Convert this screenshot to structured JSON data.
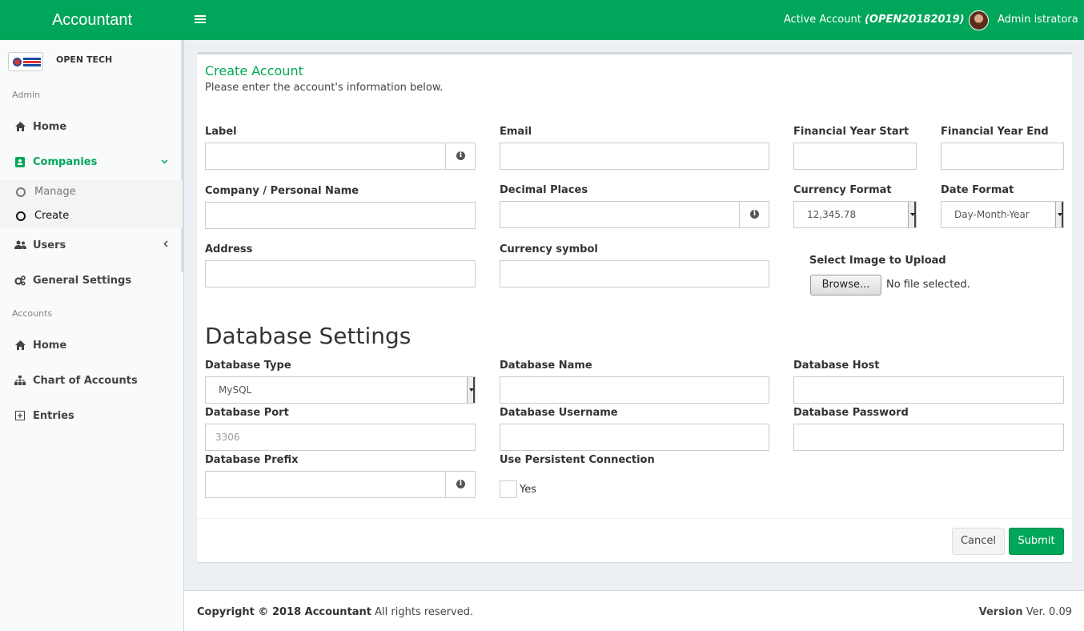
{
  "header": {
    "brand": "Accountant",
    "active_account_label": "Active Account",
    "active_account_code": "(OPEN20182019)",
    "user_name": "Admin istratora"
  },
  "sidebar": {
    "org_name": "OPEN TECH",
    "section_admin": "Admin",
    "section_accounts": "Accounts",
    "admin_items": [
      {
        "label": "Home",
        "icon": "home-icon"
      },
      {
        "label": "Companies",
        "icon": "address-card-icon"
      },
      {
        "label": "Users",
        "icon": "users-icon"
      },
      {
        "label": "General Settings",
        "icon": "gears-icon"
      }
    ],
    "companies_sub": [
      {
        "label": "Manage"
      },
      {
        "label": "Create"
      }
    ],
    "accounts_items": [
      {
        "label": "Home",
        "icon": "home-icon"
      },
      {
        "label": "Chart of Accounts",
        "icon": "sitemap-icon"
      },
      {
        "label": "Entries",
        "icon": "plus-square-icon"
      }
    ]
  },
  "form": {
    "title": "Create Account",
    "subtitle": "Please enter the account's information below.",
    "label_label": "Label",
    "email_label": "Email",
    "fy_start_label": "Financial Year Start",
    "fy_end_label": "Financial Year End",
    "company_label": "Company / Personal Name",
    "decimal_label": "Decimal Places",
    "currency_format_label": "Currency Format",
    "currency_format_value": "12,345.78",
    "date_format_label": "Date Format",
    "date_format_value": "Day-Month-Year",
    "address_label": "Address",
    "currency_symbol_label": "Currency symbol",
    "image_label": "Select Image to Upload",
    "browse_button": "Browse...",
    "file_status": "No file selected."
  },
  "database": {
    "title": "Database Settings",
    "type_label": "Database Type",
    "type_value": "MySQL",
    "name_label": "Database Name",
    "host_label": "Database Host",
    "port_label": "Database Port",
    "port_placeholder": "3306",
    "username_label": "Database Username",
    "password_label": "Database Password",
    "prefix_label": "Database Prefix",
    "persistent_label": "Use Persistent Connection",
    "persistent_option": "Yes"
  },
  "actions": {
    "cancel": "Cancel",
    "submit": "Submit"
  },
  "footer": {
    "copyright_bold": "Copyright © 2018 Accountant",
    "copyright_rest": " All rights reserved.",
    "version_label": "Version",
    "version_value": " Ver. 0.09"
  },
  "colors": {
    "brand_green": "#00a65a",
    "background": "#ecf0f5"
  }
}
